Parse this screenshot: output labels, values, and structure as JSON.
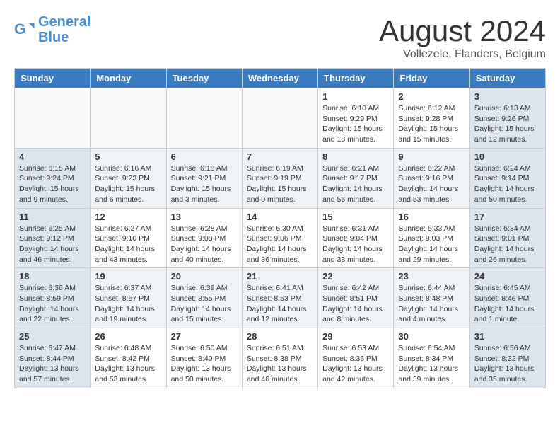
{
  "header": {
    "logo_line1": "General",
    "logo_line2": "Blue",
    "month_title": "August 2024",
    "location": "Vollezele, Flanders, Belgium"
  },
  "days_of_week": [
    "Sunday",
    "Monday",
    "Tuesday",
    "Wednesday",
    "Thursday",
    "Friday",
    "Saturday"
  ],
  "weeks": [
    [
      {
        "day": "",
        "info": ""
      },
      {
        "day": "",
        "info": ""
      },
      {
        "day": "",
        "info": ""
      },
      {
        "day": "",
        "info": ""
      },
      {
        "day": "1",
        "info": "Sunrise: 6:10 AM\nSunset: 9:29 PM\nDaylight: 15 hours\nand 18 minutes."
      },
      {
        "day": "2",
        "info": "Sunrise: 6:12 AM\nSunset: 9:28 PM\nDaylight: 15 hours\nand 15 minutes."
      },
      {
        "day": "3",
        "info": "Sunrise: 6:13 AM\nSunset: 9:26 PM\nDaylight: 15 hours\nand 12 minutes."
      }
    ],
    [
      {
        "day": "4",
        "info": "Sunrise: 6:15 AM\nSunset: 9:24 PM\nDaylight: 15 hours\nand 9 minutes."
      },
      {
        "day": "5",
        "info": "Sunrise: 6:16 AM\nSunset: 9:23 PM\nDaylight: 15 hours\nand 6 minutes."
      },
      {
        "day": "6",
        "info": "Sunrise: 6:18 AM\nSunset: 9:21 PM\nDaylight: 15 hours\nand 3 minutes."
      },
      {
        "day": "7",
        "info": "Sunrise: 6:19 AM\nSunset: 9:19 PM\nDaylight: 15 hours\nand 0 minutes."
      },
      {
        "day": "8",
        "info": "Sunrise: 6:21 AM\nSunset: 9:17 PM\nDaylight: 14 hours\nand 56 minutes."
      },
      {
        "day": "9",
        "info": "Sunrise: 6:22 AM\nSunset: 9:16 PM\nDaylight: 14 hours\nand 53 minutes."
      },
      {
        "day": "10",
        "info": "Sunrise: 6:24 AM\nSunset: 9:14 PM\nDaylight: 14 hours\nand 50 minutes."
      }
    ],
    [
      {
        "day": "11",
        "info": "Sunrise: 6:25 AM\nSunset: 9:12 PM\nDaylight: 14 hours\nand 46 minutes."
      },
      {
        "day": "12",
        "info": "Sunrise: 6:27 AM\nSunset: 9:10 PM\nDaylight: 14 hours\nand 43 minutes."
      },
      {
        "day": "13",
        "info": "Sunrise: 6:28 AM\nSunset: 9:08 PM\nDaylight: 14 hours\nand 40 minutes."
      },
      {
        "day": "14",
        "info": "Sunrise: 6:30 AM\nSunset: 9:06 PM\nDaylight: 14 hours\nand 36 minutes."
      },
      {
        "day": "15",
        "info": "Sunrise: 6:31 AM\nSunset: 9:04 PM\nDaylight: 14 hours\nand 33 minutes."
      },
      {
        "day": "16",
        "info": "Sunrise: 6:33 AM\nSunset: 9:03 PM\nDaylight: 14 hours\nand 29 minutes."
      },
      {
        "day": "17",
        "info": "Sunrise: 6:34 AM\nSunset: 9:01 PM\nDaylight: 14 hours\nand 26 minutes."
      }
    ],
    [
      {
        "day": "18",
        "info": "Sunrise: 6:36 AM\nSunset: 8:59 PM\nDaylight: 14 hours\nand 22 minutes."
      },
      {
        "day": "19",
        "info": "Sunrise: 6:37 AM\nSunset: 8:57 PM\nDaylight: 14 hours\nand 19 minutes."
      },
      {
        "day": "20",
        "info": "Sunrise: 6:39 AM\nSunset: 8:55 PM\nDaylight: 14 hours\nand 15 minutes."
      },
      {
        "day": "21",
        "info": "Sunrise: 6:41 AM\nSunset: 8:53 PM\nDaylight: 14 hours\nand 12 minutes."
      },
      {
        "day": "22",
        "info": "Sunrise: 6:42 AM\nSunset: 8:51 PM\nDaylight: 14 hours\nand 8 minutes."
      },
      {
        "day": "23",
        "info": "Sunrise: 6:44 AM\nSunset: 8:48 PM\nDaylight: 14 hours\nand 4 minutes."
      },
      {
        "day": "24",
        "info": "Sunrise: 6:45 AM\nSunset: 8:46 PM\nDaylight: 14 hours\nand 1 minute."
      }
    ],
    [
      {
        "day": "25",
        "info": "Sunrise: 6:47 AM\nSunset: 8:44 PM\nDaylight: 13 hours\nand 57 minutes."
      },
      {
        "day": "26",
        "info": "Sunrise: 6:48 AM\nSunset: 8:42 PM\nDaylight: 13 hours\nand 53 minutes."
      },
      {
        "day": "27",
        "info": "Sunrise: 6:50 AM\nSunset: 8:40 PM\nDaylight: 13 hours\nand 50 minutes."
      },
      {
        "day": "28",
        "info": "Sunrise: 6:51 AM\nSunset: 8:38 PM\nDaylight: 13 hours\nand 46 minutes."
      },
      {
        "day": "29",
        "info": "Sunrise: 6:53 AM\nSunset: 8:36 PM\nDaylight: 13 hours\nand 42 minutes."
      },
      {
        "day": "30",
        "info": "Sunrise: 6:54 AM\nSunset: 8:34 PM\nDaylight: 13 hours\nand 39 minutes."
      },
      {
        "day": "31",
        "info": "Sunrise: 6:56 AM\nSunset: 8:32 PM\nDaylight: 13 hours\nand 35 minutes."
      }
    ]
  ]
}
